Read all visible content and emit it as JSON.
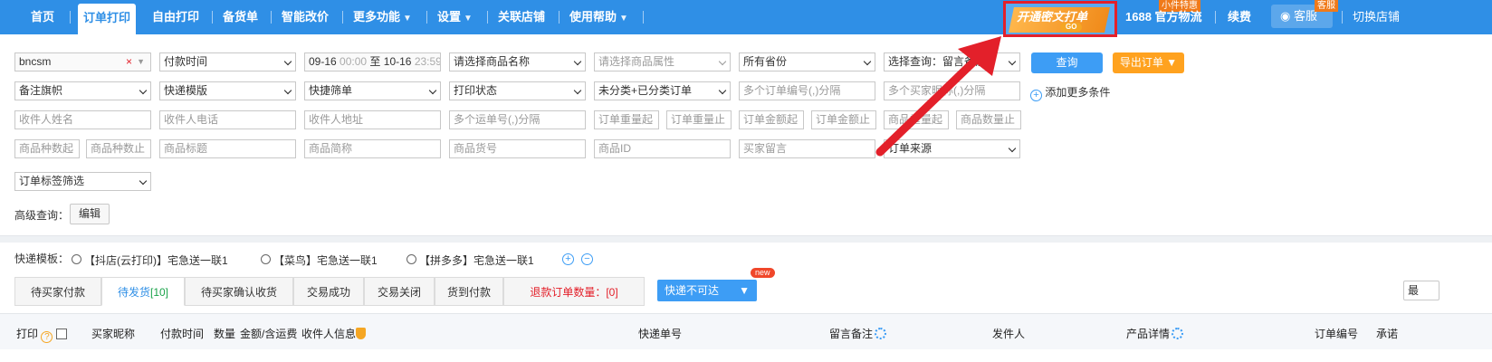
{
  "nav": {
    "items": [
      "首页",
      "订单打印",
      "自由打印",
      "备货单",
      "智能改价",
      "更多功能",
      "设置",
      "关联店铺",
      "使用帮助"
    ],
    "promo_text": "开通密文打单",
    "promo_go": "GO",
    "promo_badge": "小件特惠",
    "logistics": "1688 官方物流",
    "renew": "续费",
    "service": "客服",
    "service_badge": "客服",
    "switch_shop": "切换店铺"
  },
  "filters": {
    "row1": {
      "shop_value": "bncsm",
      "time_type": "付款时间",
      "date_from": "09-16",
      "time_from": "00:00",
      "to": "至",
      "date_to": "10-16",
      "time_to": "23:59",
      "product_name": "请选择商品名称",
      "product_attr": "请选择商品属性",
      "province": "所有省份",
      "query_select": "选择查询：留言备注",
      "query_button": "查询",
      "export_button": "导出订单"
    },
    "row2": {
      "memo_flag": "备注旗帜",
      "express_template": "快递模版",
      "quick_filter": "快捷筛单",
      "print_status": "打印状态",
      "category": "未分类+已分类订单",
      "order_nos_ph": "多个订单编号(,)分隔",
      "buyer_ids_ph": "多个买家昵称(,)分隔",
      "add_more": "添加更多条件"
    },
    "row3": [
      "收件人姓名",
      "收件人电话",
      "收件人地址",
      "多个运单号(,)分隔",
      "订单重量起",
      "订单重量止",
      "订单金额起",
      "订单金额止",
      "商品重量起",
      "商品数量止"
    ],
    "row4": [
      "商品种数起",
      "商品种数止",
      "商品标题",
      "商品简称",
      "商品货号",
      "商品ID",
      "买家留言"
    ],
    "order_source": "订单来源",
    "tag_filter": "订单标签筛选",
    "advanced_label": "高级查询：",
    "edit_button": "编辑"
  },
  "templates": {
    "label": "快递模板：",
    "options": [
      "【抖店(云打印)】宅急送一联1",
      "【菜鸟】宅急送一联1",
      "【拼多多】宅急送一联1"
    ]
  },
  "tabs": {
    "items": [
      "待买家付款",
      "待发货",
      "待买家确认收货",
      "交易成功",
      "交易关闭",
      "货到付款"
    ],
    "pending_count": "[10]",
    "refund_label": "退款订单数量：",
    "refund_count": "[0]",
    "unreachable": "快递不可达",
    "new_badge": "new",
    "right_button": "最"
  },
  "table_header": {
    "print": "打印",
    "buyer": "买家昵称",
    "pay_time": "付款时间",
    "qty": "数量",
    "amount": "金额/含运费",
    "receiver": "收件人信息",
    "tracking": "快递单号",
    "memo": "留言备注",
    "sender": "发件人",
    "product": "产品详情",
    "order_no": "订单编号",
    "carrier": "承诺"
  }
}
